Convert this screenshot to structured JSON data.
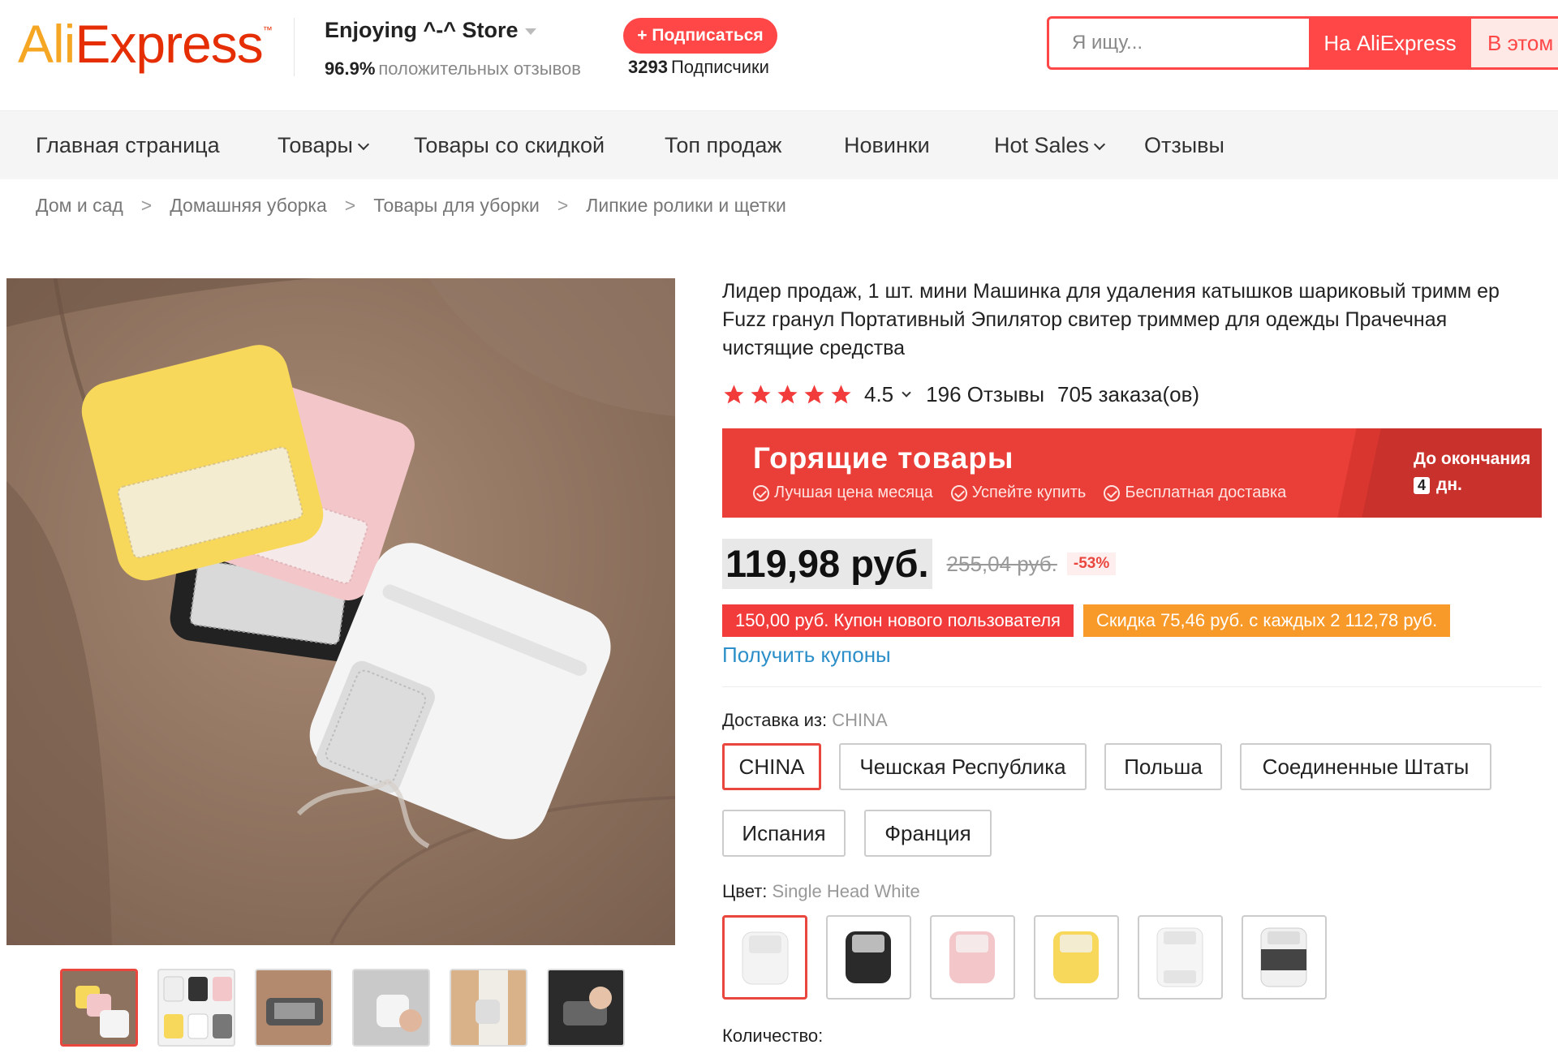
{
  "header": {
    "logo_ali": "Ali",
    "logo_express": "Express",
    "logo_tm": "™",
    "store_name": "Enjoying ^-^ Store",
    "positive_percent": "96.9%",
    "positive_label": "положительных отзывов",
    "subscribe_label": "+ Подписаться",
    "followers_count": "3293",
    "followers_label": "Подписчики",
    "search_placeholder": "Я ищу...",
    "search_on_aliexpress": "На AliExpress",
    "search_in_store": "В этом"
  },
  "nav": {
    "items": [
      {
        "label": "Главная страница",
        "has_dropdown": false
      },
      {
        "label": "Товары",
        "has_dropdown": true
      },
      {
        "label": "Товары со скидкой",
        "has_dropdown": false
      },
      {
        "label": "Топ продаж",
        "has_dropdown": false
      },
      {
        "label": "Новинки",
        "has_dropdown": false
      },
      {
        "label": "Hot Sales",
        "has_dropdown": true
      },
      {
        "label": "Отзывы",
        "has_dropdown": false
      }
    ]
  },
  "breadcrumb": [
    "Дом и сад",
    "Домашняя уборка",
    "Товары для уборки",
    "Липкие ролики и щетки"
  ],
  "product": {
    "title": "Лидер продаж, 1 шт. мини Машинка для удаления катышков шариковый тримм ер Fuzz гранул Портативный Эпилятор свитер триммер для одежды Прачечная чистящие средства",
    "rating": "4.5",
    "stars": 5,
    "reviews": "196 Отзывы",
    "orders": "705 заказа(ов)",
    "hot_banner": {
      "title": "Горящие товары",
      "perks": [
        "Лучшая цена месяца",
        "Успейте купить",
        "Бесплатная доставка"
      ],
      "countdown_label": "До окончания",
      "countdown_days": "4",
      "countdown_unit": "дн."
    },
    "price": "119,98 руб.",
    "old_price": "255,04 руб.",
    "discount": "-53%",
    "coupons": [
      {
        "label": "150,00 руб. Купон нового пользователя",
        "color": "#f23c3c"
      },
      {
        "label": "Скидка 75,46 руб. с каждых 2 112,78 руб.",
        "color": "#f89a2a"
      }
    ],
    "get_coupons": "Получить купоны",
    "shipping": {
      "label": "Доставка из:",
      "selected": "CHINA",
      "options": [
        "CHINA",
        "Чешская Республика",
        "Польша",
        "Соединенные Штаты",
        "Испания",
        "Франция"
      ]
    },
    "color": {
      "label": "Цвет:",
      "selected": "Single Head White",
      "swatches": [
        "white",
        "black",
        "pink",
        "yellow",
        "white-double",
        "grey-double"
      ]
    },
    "quantity_label": "Количество:"
  },
  "gallery": {
    "thumbnail_count": 6,
    "active_thumbnail": 1
  },
  "colors": {
    "accent": "#ff4747",
    "banner": "#ea3f38",
    "link": "#2c8fc9"
  }
}
